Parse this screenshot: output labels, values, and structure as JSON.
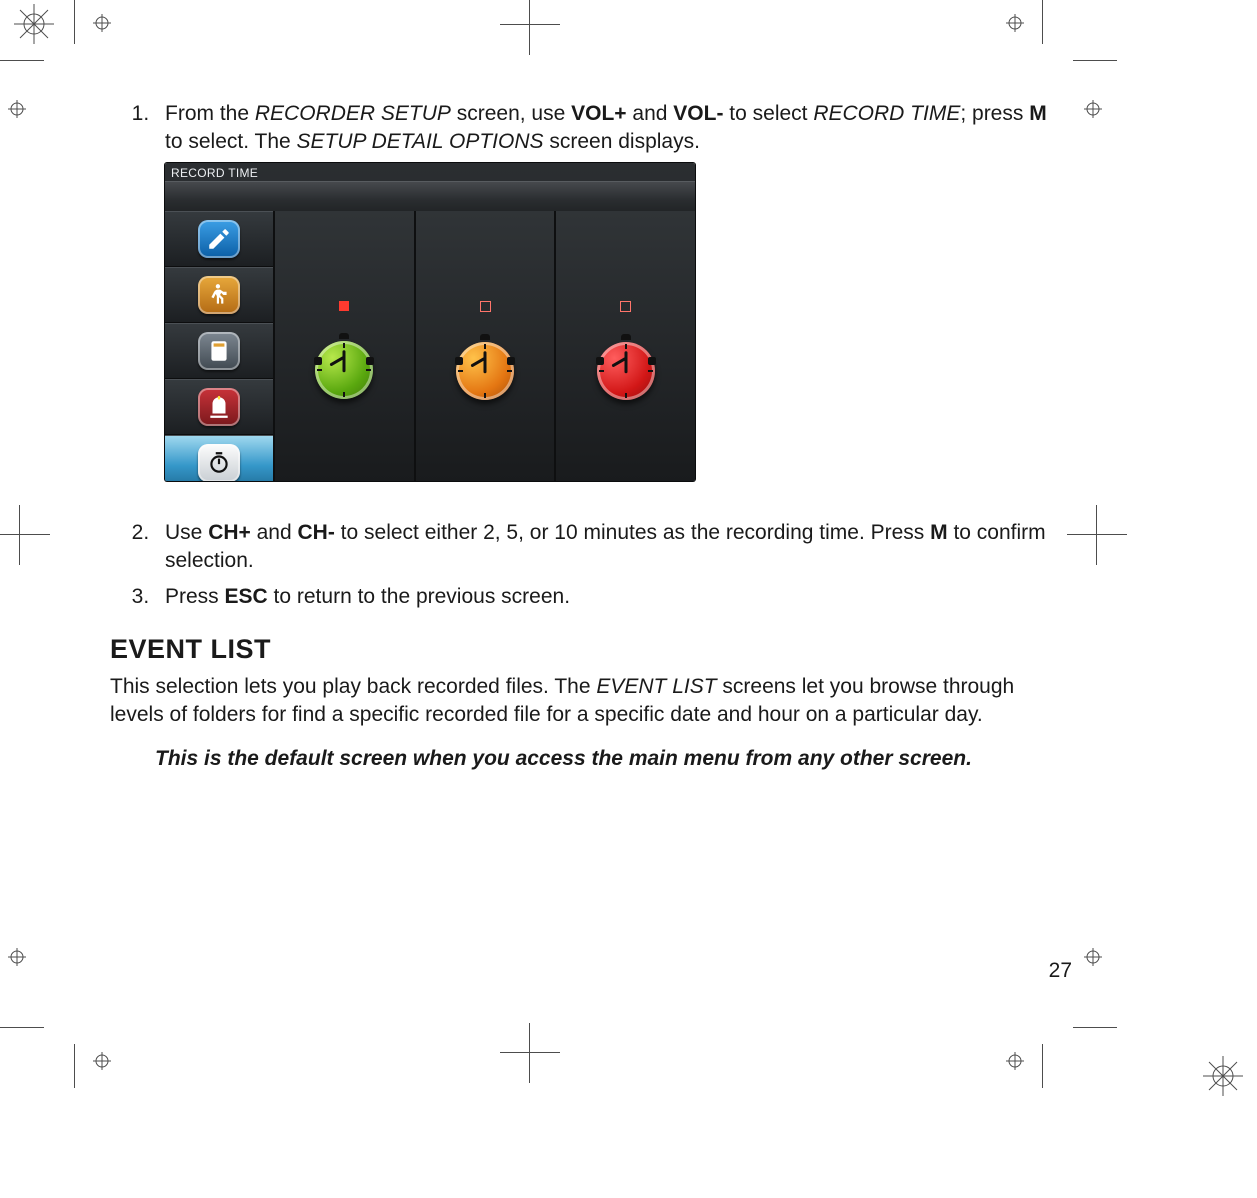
{
  "steps": {
    "1": {
      "pre1": "From the ",
      "it1": "RECORDER SETUP",
      "mid1": " screen, use ",
      "b1": "VOL+",
      "mid2": " and ",
      "b2": "VOL-",
      "mid3": " to select ",
      "it2": "RECORD TIME",
      "mid4": "; press ",
      "b3": "M",
      "mid5": " to select. The ",
      "it3": "SETUP DETAIL OPTIONS",
      "mid6": " screen displays."
    },
    "2": {
      "pre": "Use ",
      "b1": "CH+",
      "mid1": " and ",
      "b2": "CH-",
      "mid2": " to select either 2, 5, or 10 minutes as the recording time. Press ",
      "b3": "M",
      "tail": " to confirm selection."
    },
    "3": {
      "pre": "Press ",
      "b1": "ESC",
      "tail": " to return to the previous screen."
    }
  },
  "section": {
    "title": "EVENT LIST",
    "p1_a": "This selection lets you play back recorded files. The  ",
    "p1_it": "EVENT LIST",
    "p1_b": " screens let you browse through levels of folders for find a specific recorded file for a specific date and hour on a particular day.",
    "note": "This is the default screen when you access the main menu from any other screen."
  },
  "ui": {
    "title": "RECORD TIME",
    "sidebar_icons": [
      "edit-icon",
      "motion-icon",
      "storage-icon",
      "alarm-icon",
      "timer-icon"
    ],
    "options": [
      {
        "color": "green",
        "marker": "solid"
      },
      {
        "color": "orange",
        "marker": "outline"
      },
      {
        "color": "red",
        "marker": "outline"
      }
    ]
  },
  "page_number": "27"
}
